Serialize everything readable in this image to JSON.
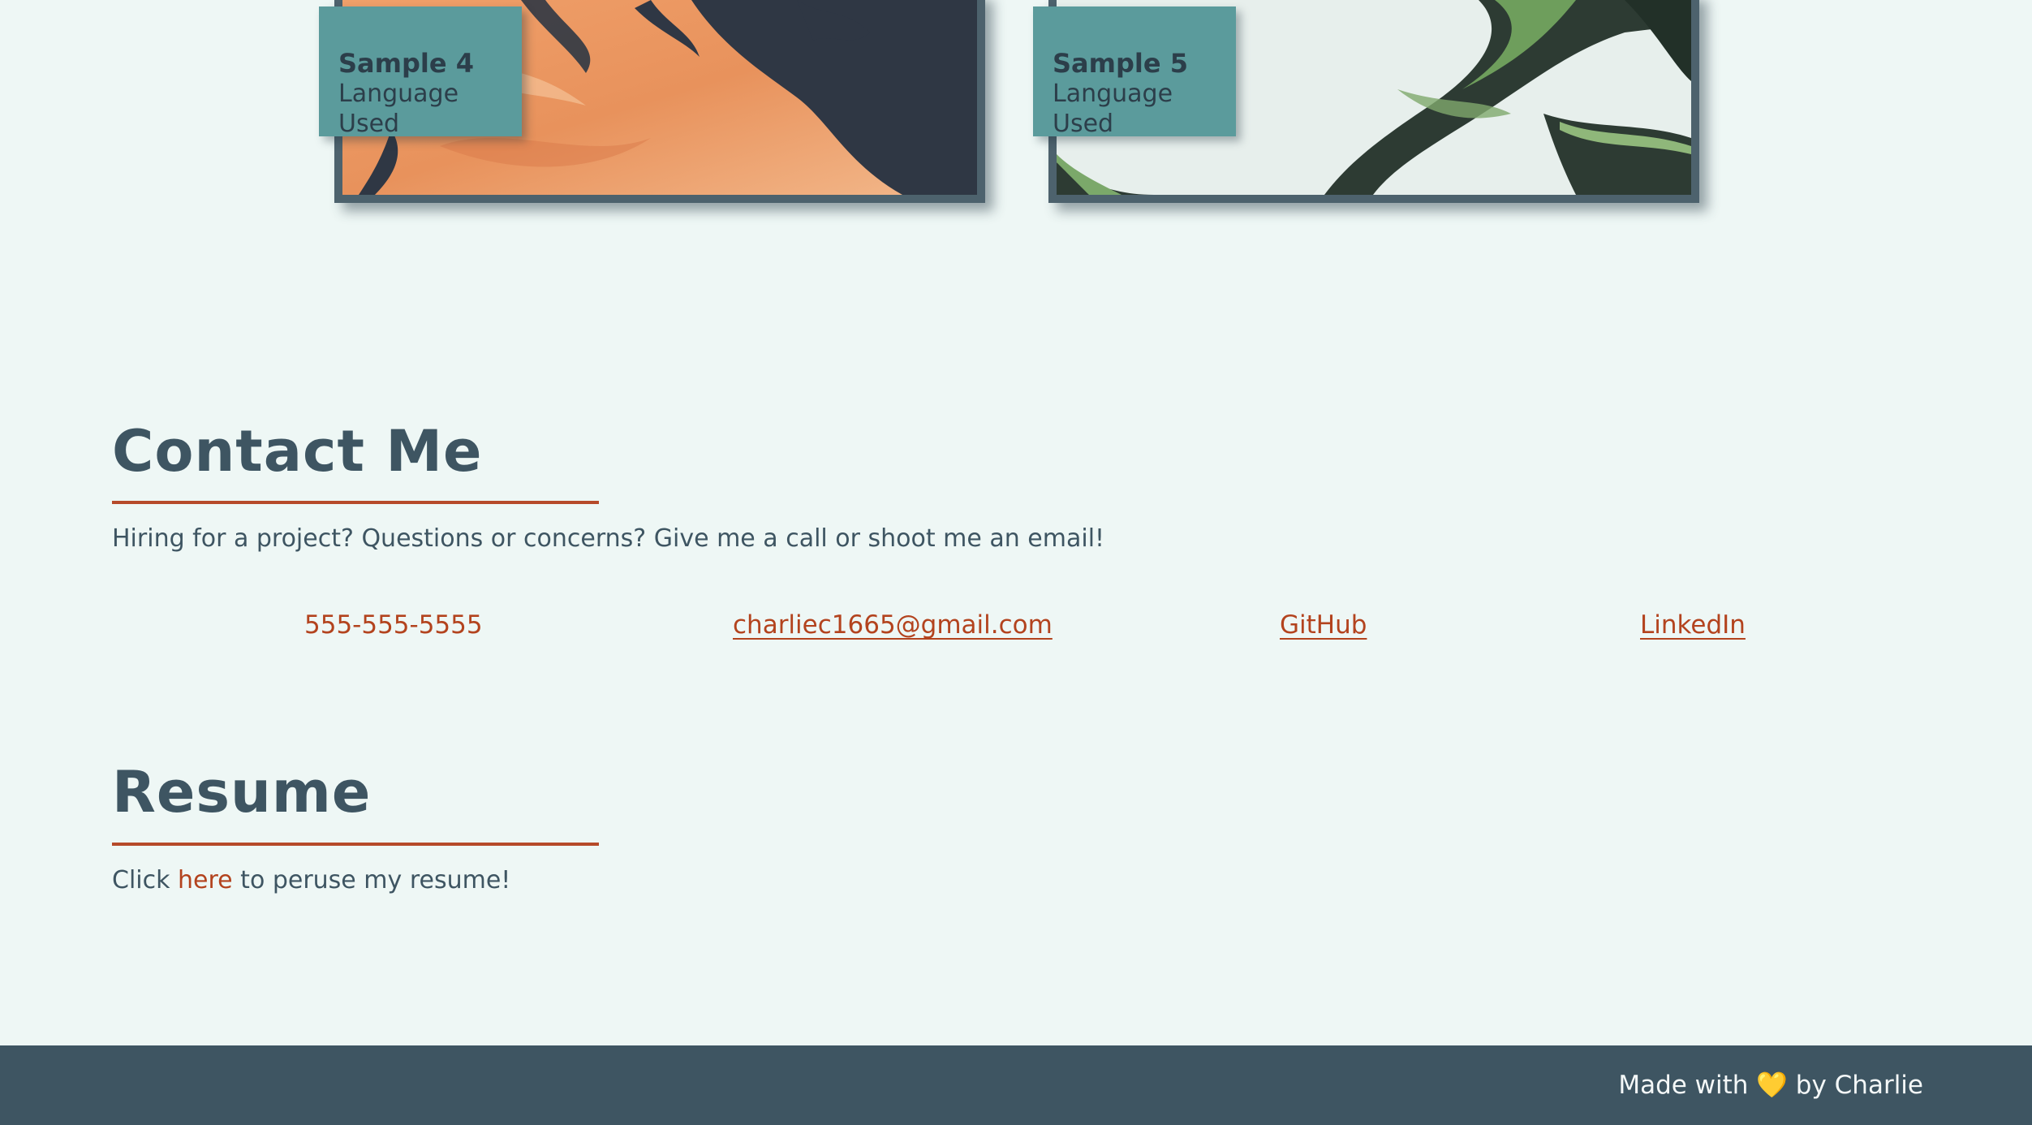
{
  "projects": [
    {
      "title": "Sample 4",
      "language": "Language Used"
    },
    {
      "title": "Sample 5",
      "language": "Language Used"
    }
  ],
  "contact": {
    "heading": "Contact Me",
    "intro": "Hiring for a project? Questions or concerns? Give me a call or shoot me an email!",
    "phone": "555-555-5555",
    "email": "charliec1665@gmail.com",
    "github": "GitHub",
    "linkedin": "LinkedIn"
  },
  "resume": {
    "heading": "Resume",
    "text_before": "Click ",
    "link": "here",
    "text_after": " to peruse my resume!"
  },
  "footer": {
    "text_before": "Made with ",
    "heart": "💛",
    "text_after": " by Charlie"
  },
  "colors": {
    "background": "#eef7f5",
    "heading": "#3e5562",
    "accent": "#b3431e",
    "label_bg": "#5b9b9c",
    "footer_bg": "#3e5562"
  }
}
